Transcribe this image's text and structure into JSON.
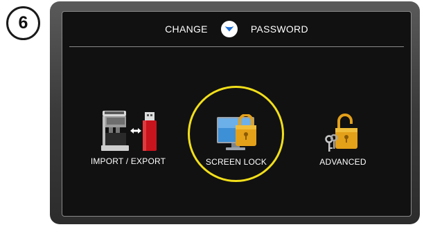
{
  "step": {
    "number": "6"
  },
  "header": {
    "left_label": "CHANGE",
    "right_label": "PASSWORD",
    "center_icon": "down-chevron-circle-icon"
  },
  "tiles": [
    {
      "label": "IMPORT / EXPORT",
      "icon": "coffee-machine-usb-transfer-icon"
    },
    {
      "label": "SCREEN LOCK",
      "icon": "monitor-padlock-icon",
      "highlighted": true
    },
    {
      "label": "ADVANCED",
      "icon": "padlock-keys-icon"
    }
  ],
  "colors": {
    "screen_bg": "#111111",
    "highlight_ring": "#f2df1a",
    "accent_blue": "#1d6fd6",
    "lock_gold": "#e3a019",
    "usb_red": "#c8141c"
  }
}
